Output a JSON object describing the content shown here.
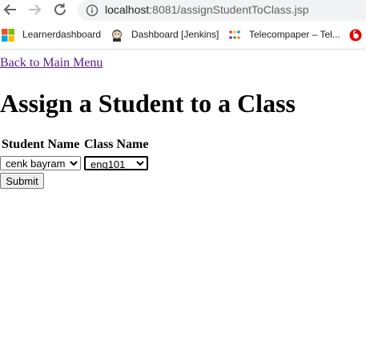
{
  "browser": {
    "url_host": "localhost",
    "url_rest": ":8081/assignStudentToClass.jsp",
    "bookmarks": [
      {
        "label": "Learnerdashboard",
        "icon": "microsoft-logo-icon"
      },
      {
        "label": "Dashboard [Jenkins]",
        "icon": "jenkins-icon"
      },
      {
        "label": "Telecompaper – Tel...",
        "icon": "telecompaper-icon"
      },
      {
        "label": "",
        "icon": "vodafone-icon"
      }
    ]
  },
  "page": {
    "back_link": "Back to Main Menu",
    "title": "Assign a Student to a Class",
    "form": {
      "student_header": "Student Name",
      "class_header": "Class Name",
      "student_selected": "cenk bayram",
      "class_selected": "eng101",
      "submit_label": "Submit"
    }
  },
  "colors": {
    "link_visited": "#551a8b",
    "omnibox_bg": "#f1f3f4",
    "button_bg": "#efefef"
  }
}
